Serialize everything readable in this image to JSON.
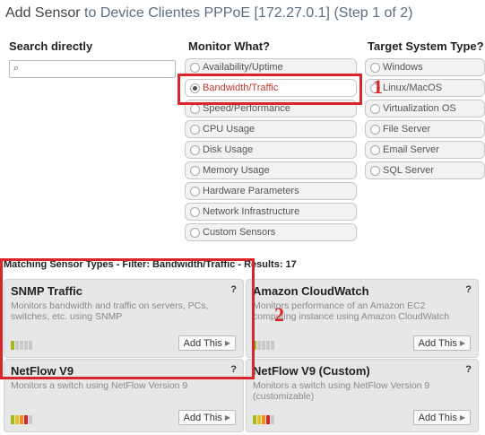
{
  "title": {
    "prefix": "Add Sensor",
    "rest": " to Device Clientes PPPoE [172.27.0.1] (Step 1 of 2)"
  },
  "search": {
    "heading": "Search directly",
    "icon": "search-icon",
    "value": ""
  },
  "monitor": {
    "heading": "Monitor What?",
    "options": [
      {
        "label": "Availability/Uptime",
        "selected": false
      },
      {
        "label": "Bandwidth/Traffic",
        "selected": true
      },
      {
        "label": "Speed/Performance",
        "selected": false
      },
      {
        "label": "CPU Usage",
        "selected": false
      },
      {
        "label": "Disk Usage",
        "selected": false
      },
      {
        "label": "Memory Usage",
        "selected": false
      },
      {
        "label": "Hardware Parameters",
        "selected": false
      },
      {
        "label": "Network Infrastructure",
        "selected": false
      },
      {
        "label": "Custom Sensors",
        "selected": false
      }
    ]
  },
  "target": {
    "heading": "Target System Type?",
    "options": [
      {
        "label": "Windows",
        "selected": false
      },
      {
        "label": "Linux/MacOS",
        "selected": false
      },
      {
        "label": "Virtualization OS",
        "selected": false
      },
      {
        "label": "File Server",
        "selected": false
      },
      {
        "label": "Email Server",
        "selected": false
      },
      {
        "label": "SQL Server",
        "selected": false
      }
    ]
  },
  "results": {
    "text": "Matching Sensor Types - Filter: Bandwidth/Traffic - Results: 17"
  },
  "annotations": {
    "one": "1",
    "two": "2",
    "color": "#d9262c"
  },
  "colors": {
    "selected_text": "#c0392b",
    "card_bg": "#e7e7e7"
  },
  "cards": [
    {
      "name": "SNMP Traffic",
      "help": "?",
      "desc": "Monitors bandwidth and traffic on servers, PCs, switches, etc. using SNMP",
      "add": "Add This",
      "bars": [
        "#a8b820",
        "#c9c9c9",
        "#c9c9c9",
        "#c9c9c9",
        "#c9c9c9"
      ]
    },
    {
      "name": "Amazon CloudWatch",
      "help": "?",
      "desc": "Monitors performance of an Amazon EC2 computing instance using Amazon CloudWatch",
      "add": "Add This",
      "bars": [
        "#a8b820",
        "#c9c9c9",
        "#c9c9c9",
        "#c9c9c9",
        "#c9c9c9"
      ]
    },
    {
      "name": "NetFlow V9",
      "help": "?",
      "desc": "Monitors a switch using NetFlow Version 9",
      "add": "Add This",
      "bars": [
        "#a8b820",
        "#e8c21c",
        "#e8941c",
        "#d9262c",
        "#c9c9c9"
      ]
    },
    {
      "name": "NetFlow V9 (Custom)",
      "help": "?",
      "desc": "Monitors a switch using NetFlow Version 9 (customizable)",
      "add": "Add This",
      "bars": [
        "#a8b820",
        "#e8c21c",
        "#e8941c",
        "#d9262c",
        "#c9c9c9"
      ]
    }
  ]
}
